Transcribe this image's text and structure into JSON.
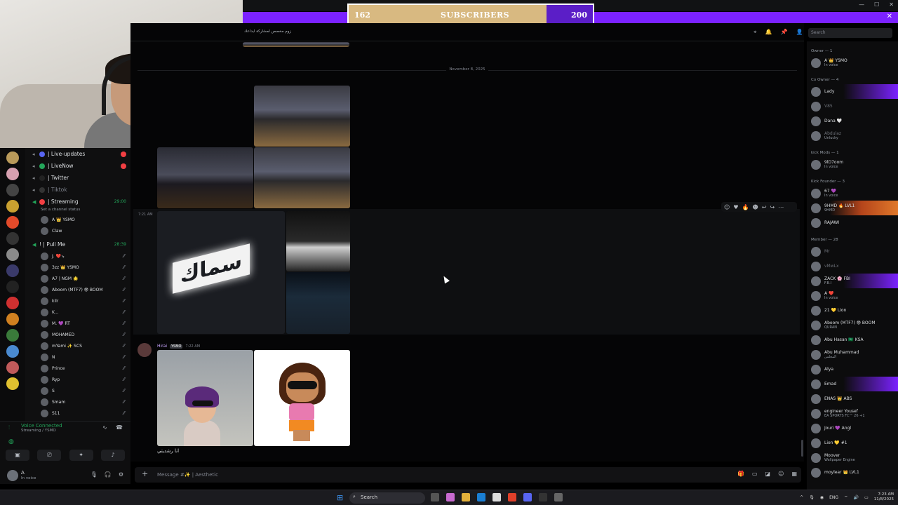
{
  "overlay": {
    "subs_current": "162",
    "subs_label": "SUBSCRIBERS",
    "subs_goal": "200",
    "subs_progress": 0.81
  },
  "window": {
    "close": "✕",
    "controls": [
      "—",
      "☐",
      "✕"
    ]
  },
  "header": {
    "topic": "زوم مخصص لمشاركة ابداعك",
    "search_placeholder": "Search"
  },
  "chat": {
    "date_divider": "November 8, 2025",
    "msg1_time": "7:21 AM",
    "sign_text": "سماك",
    "msg2_author": "Hirai",
    "msg2_tag": "YSMO",
    "msg2_time": "7:22 AM",
    "msg2_caption": "انا رشديتي",
    "composer_placeholder": "Message #✨ | Aesthetic"
  },
  "channels": {
    "items": [
      {
        "name": "| Live-updates",
        "icon": "announce-icon",
        "badge": true
      },
      {
        "name": "| LiveNow",
        "icon": "announce-icon",
        "badge": true
      },
      {
        "name": "| Twitter",
        "icon": "announce-icon"
      },
      {
        "name": "| Tiktok",
        "icon": "announce-icon",
        "muted": true
      },
      {
        "name": "| Streaming",
        "icon": "voice-icon",
        "time": "29:00"
      }
    ],
    "streaming_status": "Set a channel status",
    "streaming_users": [
      "A 👑 YSMO",
      "Claw"
    ],
    "pullme": {
      "name": "! | Pull Me",
      "time": "28:39"
    },
    "pullme_users": [
      "J. ❤️↘",
      "3zz 👑 YSMO",
      "A7 | NGM 🌟",
      "Aboom (MTF7) 😎 BOOM",
      "kilr",
      "K...",
      "M. 💜 RT",
      "MOHAMED",
      "mYami ✨ SCS",
      "N",
      "Prince",
      "Ryp",
      "S",
      "Smam",
      "S11"
    ]
  },
  "voice": {
    "title": "Voice Connected",
    "sub": "Streaming / YSMO"
  },
  "user": {
    "name": "A",
    "status": "In voice"
  },
  "members": {
    "groups": [
      {
        "title": "Owner — 1",
        "rows": [
          {
            "name": "A 👑 YSMO",
            "status": "In voice"
          }
        ]
      },
      {
        "title": "Co Owner — 4",
        "rows": [
          {
            "name": "Lady",
            "status": "",
            "style": "boost"
          },
          {
            "name": "V85",
            "status": "",
            "style": "dim"
          },
          {
            "name": "Dana 🤍",
            "status": ""
          },
          {
            "name": "Abdulaz",
            "status": "Unlucky",
            "style": "dim"
          }
        ]
      },
      {
        "title": "kick Mods — 1",
        "rows": [
          {
            "name": "9lD7oom",
            "status": "In voice"
          }
        ]
      },
      {
        "title": "Kick Founder — 3",
        "rows": [
          {
            "name": "67 💜",
            "status": "In voice"
          },
          {
            "name": "9HMD 🔥 LVL1",
            "status": "9HMD",
            "style": "fire"
          },
          {
            "name": "RAJAWI",
            "status": ""
          }
        ]
      },
      {
        "title": "Member — 28",
        "rows": [
          {
            "name": "Mr",
            "status": "",
            "style": "dim"
          },
          {
            "name": "vMwLx",
            "status": "",
            "style": "dim"
          },
          {
            "name": "ZACK 🌸 FBI",
            "status": "F.B.I",
            "style": "boost"
          },
          {
            "name": "A ❤️",
            "status": "In voice"
          },
          {
            "name": "21 💛 Lion",
            "status": ""
          },
          {
            "name": "Aboom (MTF7) 😎 BOOM",
            "status": "QURAN"
          },
          {
            "name": "Abu Hasan 🇸🇦 KSA",
            "status": ""
          },
          {
            "name": "Abu Muhammad",
            "status": "المجلس"
          },
          {
            "name": "Alya",
            "status": ""
          },
          {
            "name": "Emad",
            "status": "",
            "style": "boost"
          },
          {
            "name": "ENAS 👑 ABS",
            "status": ""
          },
          {
            "name": "engineer Yousef",
            "status": "EA SPORTS FC™ 26 +1"
          },
          {
            "name": "Jouri 💜 Angl",
            "status": ""
          },
          {
            "name": "Lion 💛 #1",
            "status": ""
          },
          {
            "name": "Moover",
            "status": "Wallpaper Engine"
          },
          {
            "name": "moylear 👑 LVL1",
            "status": ""
          }
        ]
      }
    ]
  },
  "taskbar": {
    "search": "Search",
    "lang": "ENG",
    "time": "7:23 AM",
    "date": "11/8/2025"
  },
  "colors": {
    "accent": "#7b22ff",
    "gold": "#d8b981",
    "online": "#23a55a",
    "alert": "#f23f43"
  }
}
